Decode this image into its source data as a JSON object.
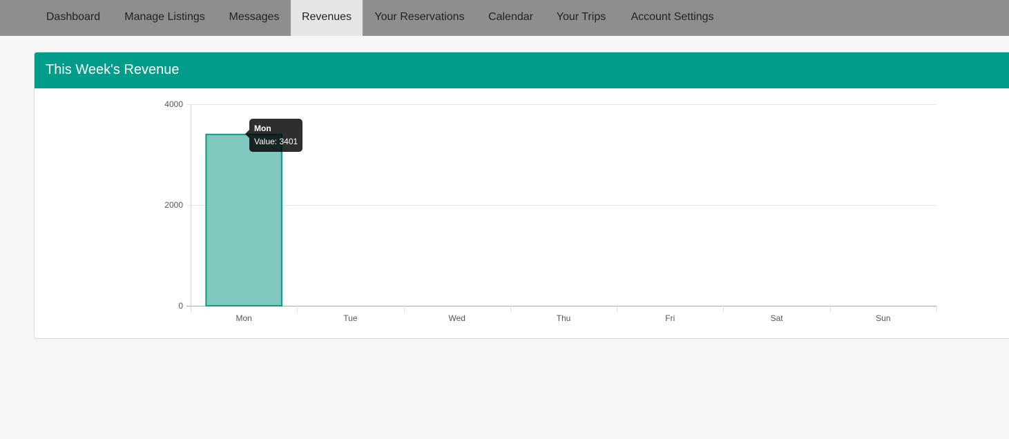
{
  "nav": {
    "items": [
      {
        "label": "Dashboard",
        "active": false
      },
      {
        "label": "Manage Listings",
        "active": false
      },
      {
        "label": "Messages",
        "active": false
      },
      {
        "label": "Revenues",
        "active": true
      },
      {
        "label": "Your Reservations",
        "active": false
      },
      {
        "label": "Calendar",
        "active": false
      },
      {
        "label": "Your Trips",
        "active": false
      },
      {
        "label": "Account Settings",
        "active": false
      }
    ]
  },
  "panel": {
    "title": "This Week's Revenue"
  },
  "tooltip": {
    "title": "Mon",
    "value": "Value: 3401"
  },
  "colors": {
    "navbar": "#8e8e8e",
    "accent": "#009c8a",
    "bar_fill": "#81c9bf",
    "bar_stroke": "#0a9a86"
  },
  "chart_data": {
    "type": "bar",
    "categories": [
      "Mon",
      "Tue",
      "Wed",
      "Thu",
      "Fri",
      "Sat",
      "Sun"
    ],
    "values": [
      3401,
      0,
      0,
      0,
      0,
      0,
      0
    ],
    "ylim": [
      0,
      4000
    ],
    "yticks": [
      0,
      2000,
      4000
    ],
    "ytick_labels": [
      "0",
      "2000",
      "4000"
    ],
    "grid": true,
    "title": "",
    "xlabel": "",
    "ylabel": ""
  }
}
